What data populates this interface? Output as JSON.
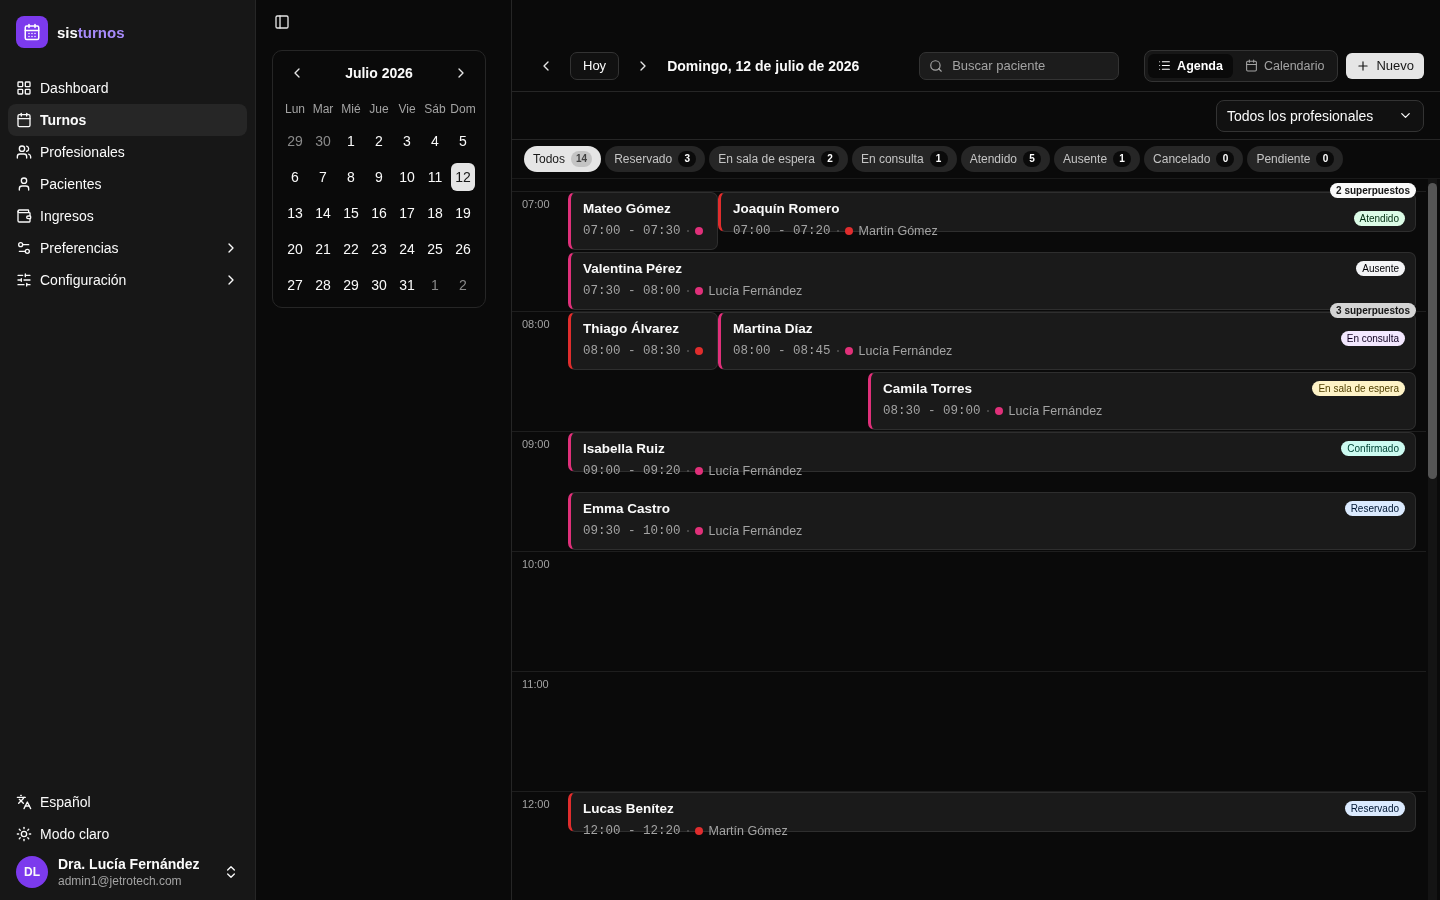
{
  "brand": {
    "part_1": "sis",
    "part_2": "turnos"
  },
  "sidebar": {
    "items": [
      {
        "label": "Dashboard",
        "selected": false,
        "has_submenu": false
      },
      {
        "label": "Turnos",
        "selected": true,
        "has_submenu": false
      },
      {
        "label": "Profesionales",
        "selected": false,
        "has_submenu": false
      },
      {
        "label": "Pacientes",
        "selected": false,
        "has_submenu": false
      },
      {
        "label": "Ingresos",
        "selected": false,
        "has_submenu": false
      },
      {
        "label": "Preferencias",
        "selected": false,
        "has_submenu": true
      },
      {
        "label": "Configuración",
        "selected": false,
        "has_submenu": true
      }
    ],
    "footer": [
      {
        "label": "Español"
      },
      {
        "label": "Modo claro"
      }
    ],
    "user": {
      "initials": "DL",
      "name": "Dra. Lucía Fernández",
      "email": "admin1@jetrotech.com"
    }
  },
  "mini_calendar": {
    "title": "Julio 2026",
    "weekdays": [
      "Lun",
      "Mar",
      "Mié",
      "Jue",
      "Vie",
      "Sáb",
      "Dom"
    ],
    "days": [
      {
        "label": "29",
        "outside": true,
        "selected": false
      },
      {
        "label": "30",
        "outside": true,
        "selected": false
      },
      {
        "label": "1",
        "outside": false,
        "selected": false
      },
      {
        "label": "2",
        "outside": false,
        "selected": false
      },
      {
        "label": "3",
        "outside": false,
        "selected": false
      },
      {
        "label": "4",
        "outside": false,
        "selected": false
      },
      {
        "label": "5",
        "outside": false,
        "selected": false
      },
      {
        "label": "6",
        "outside": false,
        "selected": false
      },
      {
        "label": "7",
        "outside": false,
        "selected": false
      },
      {
        "label": "8",
        "outside": false,
        "selected": false
      },
      {
        "label": "9",
        "outside": false,
        "selected": false
      },
      {
        "label": "10",
        "outside": false,
        "selected": false
      },
      {
        "label": "11",
        "outside": false,
        "selected": false
      },
      {
        "label": "12",
        "outside": false,
        "selected": true
      },
      {
        "label": "13",
        "outside": false,
        "selected": false
      },
      {
        "label": "14",
        "outside": false,
        "selected": false
      },
      {
        "label": "15",
        "outside": false,
        "selected": false
      },
      {
        "label": "16",
        "outside": false,
        "selected": false
      },
      {
        "label": "17",
        "outside": false,
        "selected": false
      },
      {
        "label": "18",
        "outside": false,
        "selected": false
      },
      {
        "label": "19",
        "outside": false,
        "selected": false
      },
      {
        "label": "20",
        "outside": false,
        "selected": false
      },
      {
        "label": "21",
        "outside": false,
        "selected": false
      },
      {
        "label": "22",
        "outside": false,
        "selected": false
      },
      {
        "label": "23",
        "outside": false,
        "selected": false
      },
      {
        "label": "24",
        "outside": false,
        "selected": false
      },
      {
        "label": "25",
        "outside": false,
        "selected": false
      },
      {
        "label": "26",
        "outside": false,
        "selected": false
      },
      {
        "label": "27",
        "outside": false,
        "selected": false
      },
      {
        "label": "28",
        "outside": false,
        "selected": false
      },
      {
        "label": "29",
        "outside": false,
        "selected": false
      },
      {
        "label": "30",
        "outside": false,
        "selected": false
      },
      {
        "label": "31",
        "outside": false,
        "selected": false
      },
      {
        "label": "1",
        "outside": true,
        "selected": false
      },
      {
        "label": "2",
        "outside": true,
        "selected": false
      }
    ]
  },
  "toolbar": {
    "today": "Hoy",
    "date": "Domingo, 12 de julio de 2026",
    "search": {
      "placeholder": "Buscar paciente"
    },
    "views": [
      {
        "label": "Agenda",
        "selected": true
      },
      {
        "label": "Calendario",
        "selected": false
      }
    ],
    "new_button": "Nuevo",
    "professional_filter": "Todos los profesionales"
  },
  "status_filters": [
    {
      "label": "Todos",
      "count": "14",
      "selected": true
    },
    {
      "label": "Reservado",
      "count": "3",
      "selected": false
    },
    {
      "label": "En sala de espera",
      "count": "2",
      "selected": false
    },
    {
      "label": "En consulta",
      "count": "1",
      "selected": false
    },
    {
      "label": "Atendido",
      "count": "5",
      "selected": false
    },
    {
      "label": "Ausente",
      "count": "1",
      "selected": false
    },
    {
      "label": "Cancelado",
      "count": "0",
      "selected": false
    },
    {
      "label": "Pendiente",
      "count": "0",
      "selected": false
    }
  ],
  "timeline": {
    "hours": [
      "07:00",
      "08:00",
      "09:00",
      "10:00",
      "11:00",
      "12:00"
    ],
    "appointments": [
      {
        "patient": "Mateo Gómez",
        "time": "07:00 - 07:30",
        "color": "#e0307a",
        "overlap_label": "2 superpuestos"
      },
      {
        "patient": "Joaquín Romero",
        "time": "07:00 - 07:20",
        "professional": "Martín Gómez",
        "color": "#e02d2d",
        "status": {
          "label": "Atendido",
          "color": "#dcfce7"
        }
      },
      {
        "patient": "Valentina Pérez",
        "time": "07:30 - 08:00",
        "professional": "Lucía Fernández",
        "color": "#e0307a",
        "status": {
          "label": "Ausente",
          "color": "#f3f4f6"
        }
      },
      {
        "patient": "Thiago Álvarez",
        "time": "08:00 - 08:30",
        "color": "#e02d2d",
        "overlap_label": "3 superpuestos"
      },
      {
        "patient": "Martina Díaz",
        "time": "08:00 - 08:45",
        "professional": "Lucía Fernández",
        "color": "#e0307a",
        "status": {
          "label": "En consulta",
          "color": "#f3e8ff"
        }
      },
      {
        "patient": "Camila Torres",
        "time": "08:30 - 09:00",
        "professional": "Lucía Fernández",
        "color": "#e0307a",
        "status": {
          "label": "En sala de espera",
          "color": "#fef3c7"
        }
      },
      {
        "patient": "Isabella Ruiz",
        "time": "09:00 - 09:20",
        "professional": "Lucía Fernández",
        "color": "#e0307a",
        "status": {
          "label": "Confirmado",
          "color": "#ccfbf1"
        }
      },
      {
        "patient": "Emma Castro",
        "time": "09:30 - 10:00",
        "professional": "Lucía Fernández",
        "color": "#e0307a",
        "status": {
          "label": "Reservado",
          "color": "#dbeafe"
        }
      },
      {
        "patient": "Lucas Benítez",
        "time": "12:00 - 12:20",
        "professional": "Martín Gómez",
        "color": "#e02d2d",
        "status": {
          "label": "Reservado",
          "color": "#dbeafe"
        }
      }
    ]
  }
}
